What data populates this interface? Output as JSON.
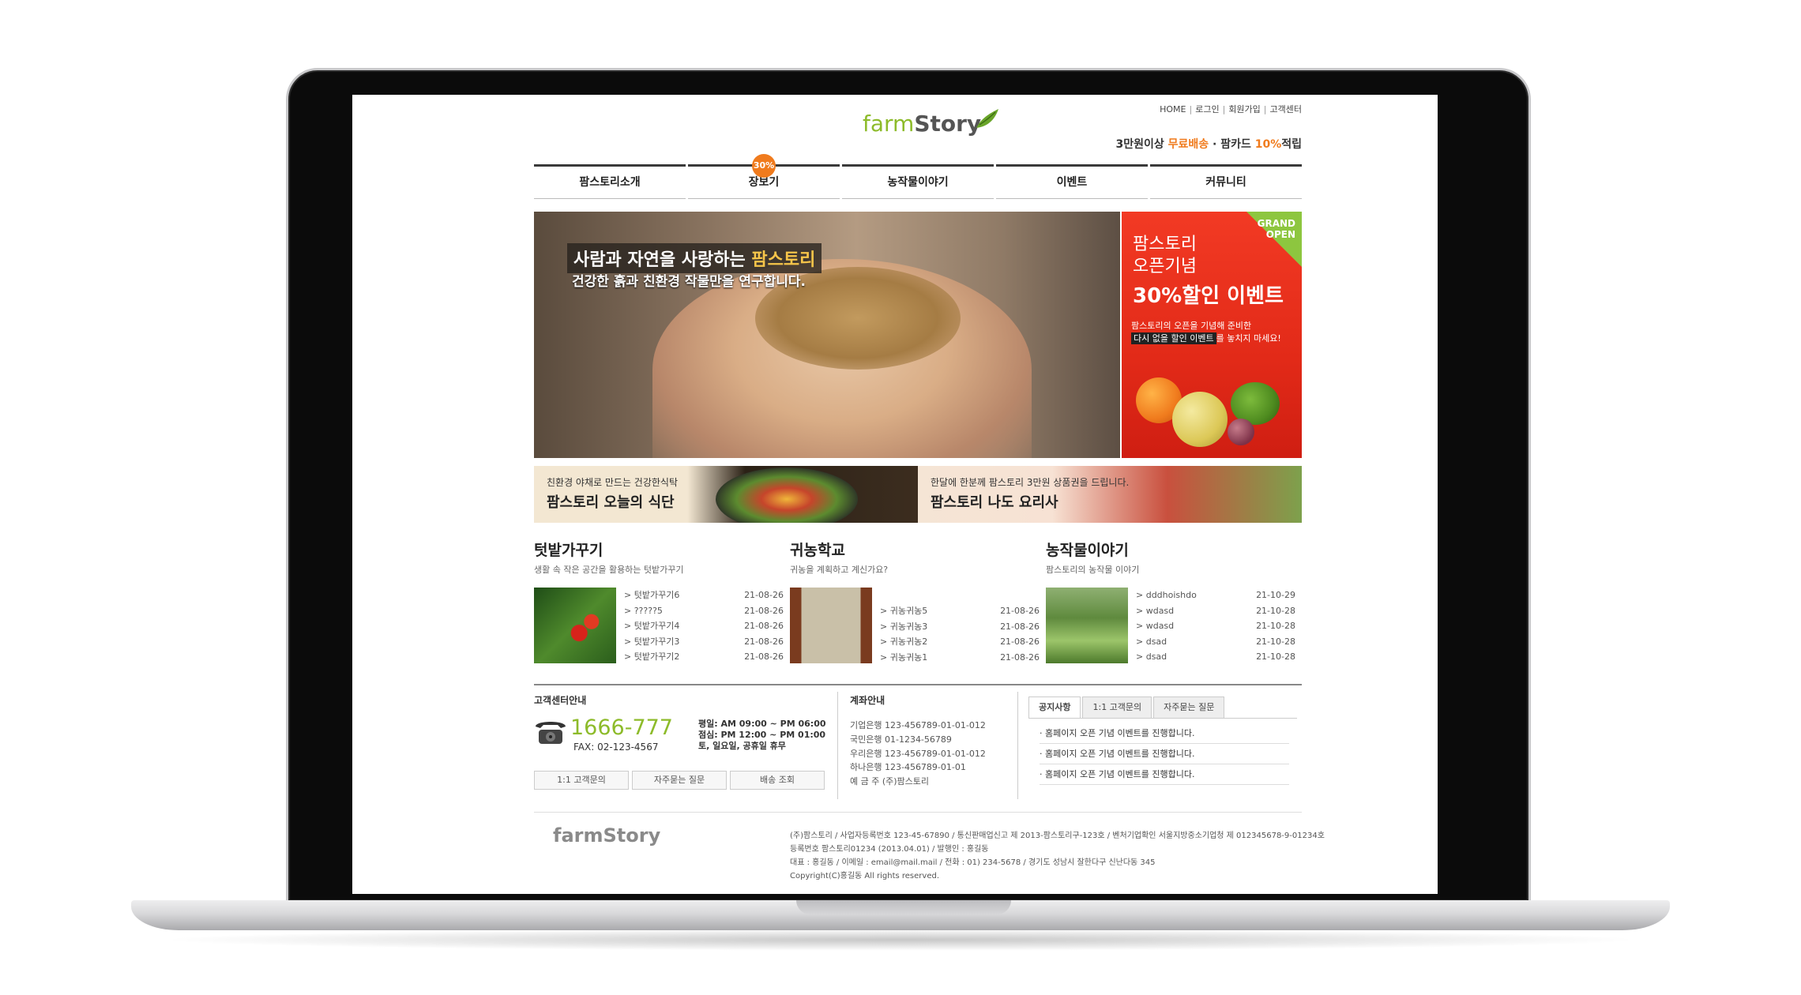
{
  "top_nav": [
    "HOME",
    "로그인",
    "회원가입",
    "고객센터"
  ],
  "logo": {
    "part1": "farm",
    "part2": "Story"
  },
  "promo": {
    "text1": "3만원이상 ",
    "highlight1": "무료배송",
    "text2": " · 팜카드 ",
    "highlight2": "10%",
    "text3": "적립"
  },
  "gnb": [
    "팜스토리소개",
    "장보기",
    "농작물이야기",
    "이벤트",
    "커뮤니티"
  ],
  "gnb_badge": "30%",
  "hero": {
    "title": "사람과 자연을 사랑하는 ",
    "title_hl": "팜스토리",
    "subtitle": "건강한 흙과 친환경 작물만을 연구합니다."
  },
  "event": {
    "corner": "GRAND OPEN",
    "line1": "팜스토리",
    "line2": "오픈기념",
    "line3": "30%할인 이벤트",
    "desc1": "팜스토리의 오픈을 기념해 준비한",
    "desc2_box": "다시 없을 할인 이벤트",
    "desc2_rest": "를 놓치지 마세요!"
  },
  "sub_banners": [
    {
      "small": "친환경 야채로 만드는 건강한식탁",
      "big": "팜스토리 오늘의 식단"
    },
    {
      "small": "한달에 한분께 팜스토리 3만원 상품권을 드립니다.",
      "big": "팜스토리 나도 요리사"
    }
  ],
  "boards": [
    {
      "title": "텃밭가꾸기",
      "desc": "생활 속 작은 공간을 활용하는 텃밭가꾸기",
      "items": [
        {
          "t": "> 텃밭가꾸기6",
          "d": "21-08-26"
        },
        {
          "t": "> ?????5",
          "d": "21-08-26"
        },
        {
          "t": "> 텃밭가꾸기4",
          "d": "21-08-26"
        },
        {
          "t": "> 텃밭가꾸기3",
          "d": "21-08-26"
        },
        {
          "t": "> 텃밭가꾸기2",
          "d": "21-08-26"
        }
      ]
    },
    {
      "title": "귀농학교",
      "desc": "귀농을 계획하고 계신가요?",
      "items": [
        {
          "t": "> 귀농귀농5",
          "d": "21-08-26"
        },
        {
          "t": "> 귀농귀농3",
          "d": "21-08-26"
        },
        {
          "t": "> 귀농귀농2",
          "d": "21-08-26"
        },
        {
          "t": "> 귀농귀농1",
          "d": "21-08-26"
        }
      ]
    },
    {
      "title": "농작물이야기",
      "desc": "팜스토리의 농작물 이야기",
      "items": [
        {
          "t": "> dddhoishdo",
          "d": "21-10-29"
        },
        {
          "t": "> wdasd",
          "d": "21-10-28"
        },
        {
          "t": "> wdasd",
          "d": "21-10-28"
        },
        {
          "t": "> dsad",
          "d": "21-10-28"
        },
        {
          "t": "> dsad",
          "d": "21-10-28"
        }
      ]
    }
  ],
  "cs": {
    "title": "고객센터안내",
    "phone": "1666-777",
    "fax": "FAX: 02-123-4567",
    "hours": [
      "평일: AM 09:00 ~ PM 06:00",
      "점심: PM 12:00 ~ PM 01:00",
      "토, 일요일, 공휴일 휴무"
    ],
    "buttons": [
      "1:1 고객문의",
      "자주묻는 질문",
      "배송 조회"
    ]
  },
  "bank": {
    "title": "계좌안내",
    "lines": [
      "기업은행 123-456789-01-01-012",
      "국민은행 01-1234-56789",
      "우리은행 123-456789-01-01-012",
      "하나은행 123-456789-01-01",
      "예 금 주 (주)팜스토리"
    ]
  },
  "notice": {
    "tabs": [
      "공지사항",
      "1:1 고객문의",
      "자주묻는 질문"
    ],
    "items": [
      "· 홈페이지 오픈 기념 이벤트를 진행합니다.",
      "· 홈페이지 오픈 기념 이벤트를 진행합니다.",
      "· 홈페이지 오픈 기념 이벤트를 진행합니다."
    ]
  },
  "footer": {
    "logo": "farmStory",
    "lines": [
      "(주)팜스토리 / 사업자등록번호 123-45-67890 / 통신판매업신고 제 2013-팜스토리구-123호 / 벤처기업확인 서울지방중소기업청 제 012345678-9-01234호",
      "등록번호 팜스토리01234 (2013.04.01) / 발행인 : 홍길동",
      "대표 : 홍길동 / 이메일 : email@mail.mail / 전화 : 01) 234-5678 / 경기도 성남시 잘한다구 신난다동 345",
      "Copyright(C)홍길동 All rights reserved."
    ]
  },
  "colors": {
    "brand_green": "#8dbb2a",
    "accent_orange": "#f07b1d",
    "event_red": "#e22a18"
  }
}
